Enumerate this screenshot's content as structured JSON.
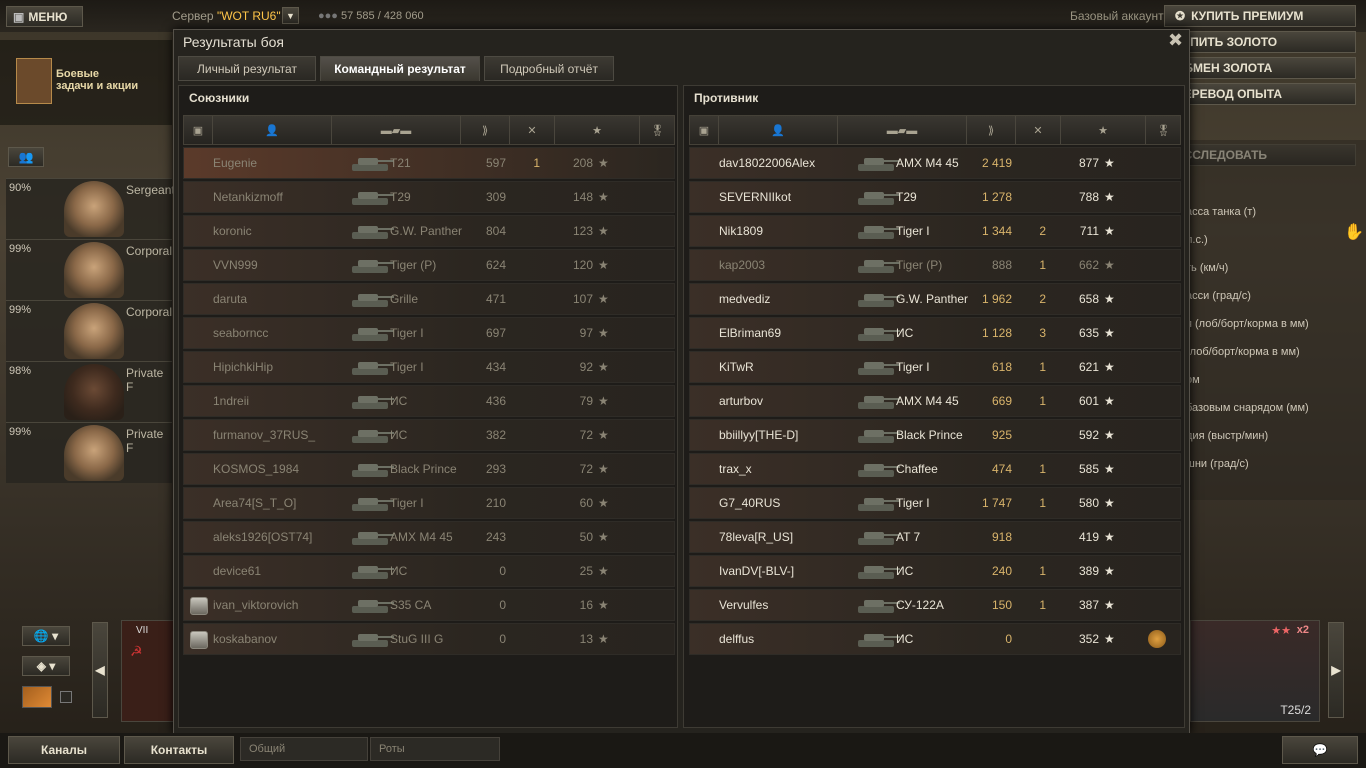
{
  "topbar": {
    "menu_label": "МЕНЮ",
    "server_label": "Сервер",
    "server_name": "\"WOT RU6\"",
    "online": "57 585 / 428 060",
    "account": "Базовый аккаунт"
  },
  "right_buttons": [
    "КУПИТЬ ПРЕМИУМ",
    "КУПИТЬ ЗОЛОТО",
    "ОБМЕН ЗОЛОТА",
    "ПЕРЕВОД ОПЫТА",
    "ИССЛЕДОВАТЬ"
  ],
  "right_stats": [
    "асса танка (т)",
    "л.с.)",
    "ть (км/ч)",
    "асси (град/с)",
    "я (лоб/борт/корма в мм)",
    "(лоб/борт/корма в мм)",
    "ом",
    "базовым снарядом (мм)",
    "дия (выстр/мин)",
    "шни (град/с)"
  ],
  "missions": {
    "line1": "Боевые",
    "line2": "задачи и акции"
  },
  "crew": [
    {
      "pct": "90%",
      "rank": "Sergeant"
    },
    {
      "pct": "99%",
      "rank": "Corporal"
    },
    {
      "pct": "99%",
      "rank": "Corporal"
    },
    {
      "pct": "98%",
      "rank": "Private F"
    },
    {
      "pct": "99%",
      "rank": "Private F"
    }
  ],
  "dialog": {
    "title": "Результаты боя",
    "tabs": [
      "Личный результат",
      "Командный результат",
      "Подробный отчёт"
    ],
    "active_tab": 1,
    "allies_title": "Союзники",
    "enemies_title": "Противник"
  },
  "allies": [
    {
      "name": "Eugenie",
      "tank": "T21",
      "dmg": "597",
      "kills": "1",
      "xp": "208",
      "self": true,
      "medal": false
    },
    {
      "name": "Netankizmoff",
      "tank": "T29",
      "dmg": "309",
      "kills": "",
      "xp": "148",
      "medal": false
    },
    {
      "name": "koronic",
      "tank": "G.W. Panther",
      "dmg": "804",
      "kills": "",
      "xp": "123",
      "medal": false
    },
    {
      "name": "VVN999",
      "tank": "Tiger (P)",
      "dmg": "624",
      "kills": "",
      "xp": "120",
      "medal": false
    },
    {
      "name": "daruta",
      "tank": "Grille",
      "dmg": "471",
      "kills": "",
      "xp": "107",
      "medal": false
    },
    {
      "name": "seaborncc",
      "tank": "Tiger I",
      "dmg": "697",
      "kills": "",
      "xp": "97",
      "medal": false
    },
    {
      "name": "HipichkiHip",
      "tank": "Tiger I",
      "dmg": "434",
      "kills": "",
      "xp": "92",
      "medal": false
    },
    {
      "name": "1ndreii",
      "tank": "ИС",
      "dmg": "436",
      "kills": "",
      "xp": "79",
      "medal": false
    },
    {
      "name": "furmanov_37RUS_",
      "tank": "ИС",
      "dmg": "382",
      "kills": "",
      "xp": "72",
      "medal": false
    },
    {
      "name": "KOSMOS_1984",
      "tank": "Black Prince",
      "dmg": "293",
      "kills": "",
      "xp": "72",
      "medal": false
    },
    {
      "name": "Area74[S_T_O]",
      "tank": "Tiger I",
      "dmg": "210",
      "kills": "",
      "xp": "60",
      "medal": false
    },
    {
      "name": "aleks1926[OST74]",
      "tank": "AMX M4 45",
      "dmg": "243",
      "kills": "",
      "xp": "50",
      "medal": false
    },
    {
      "name": "device61",
      "tank": "ИС",
      "dmg": "0",
      "kills": "",
      "xp": "25",
      "medal": false
    },
    {
      "name": "ivan_viktorovich",
      "tank": "S35 CA",
      "dmg": "0",
      "kills": "",
      "xp": "16",
      "medal": true
    },
    {
      "name": "koskabanov",
      "tank": "StuG III G",
      "dmg": "0",
      "kills": "",
      "xp": "13",
      "medal": true
    }
  ],
  "enemies": [
    {
      "name": "dav18022006Alex",
      "tank": "AMX M4 45",
      "dmg": "2 419",
      "kills": "",
      "xp": "877",
      "alive": true
    },
    {
      "name": "SEVERNIIkot",
      "tank": "T29",
      "dmg": "1 278",
      "kills": "",
      "xp": "788",
      "alive": true
    },
    {
      "name": "Nik1809",
      "tank": "Tiger I",
      "dmg": "1 344",
      "kills": "2",
      "xp": "711",
      "alive": true
    },
    {
      "name": "kap2003",
      "tank": "Tiger (P)",
      "dmg": "888",
      "kills": "1",
      "xp": "662",
      "alive": false
    },
    {
      "name": "medvediz",
      "tank": "G.W. Panther",
      "dmg": "1 962",
      "kills": "2",
      "xp": "658",
      "alive": true
    },
    {
      "name": "ElBriman69",
      "tank": "ИС",
      "dmg": "1 128",
      "kills": "3",
      "xp": "635",
      "alive": true
    },
    {
      "name": "KiTwR",
      "tank": "Tiger I",
      "dmg": "618",
      "kills": "1",
      "xp": "621",
      "alive": true
    },
    {
      "name": "arturbov",
      "tank": "AMX M4 45",
      "dmg": "669",
      "kills": "1",
      "xp": "601",
      "alive": true
    },
    {
      "name": "bbiillyy[THE-D]",
      "tank": "Black Prince",
      "dmg": "925",
      "kills": "",
      "xp": "592",
      "alive": true
    },
    {
      "name": "trax_x",
      "tank": "Chaffee",
      "dmg": "474",
      "kills": "1",
      "xp": "585",
      "alive": true
    },
    {
      "name": "G7_40RUS",
      "tank": "Tiger I",
      "dmg": "1 747",
      "kills": "1",
      "xp": "580",
      "alive": true
    },
    {
      "name": "78leva[R_US]",
      "tank": "AT 7",
      "dmg": "918",
      "kills": "",
      "xp": "419",
      "alive": true
    },
    {
      "name": "IvanDV[-BLV-]",
      "tank": "ИС",
      "dmg": "240",
      "kills": "1",
      "xp": "389",
      "alive": true
    },
    {
      "name": "Vervulfes",
      "tank": "СУ-122А",
      "dmg": "150",
      "kills": "1",
      "xp": "387",
      "alive": true
    },
    {
      "name": "delffus",
      "tank": "ИС",
      "dmg": "0",
      "kills": "",
      "xp": "352",
      "alive": true,
      "achievement": true
    }
  ],
  "carousel": {
    "tier": "VII",
    "right_tank": "T25/2",
    "right_badge": "x2"
  },
  "bottom": {
    "channels": "Каналы",
    "contacts": "Контакты",
    "general": "Общий",
    "companies": "Роты"
  },
  "colors": {
    "accent_gold": "#ffc64a",
    "xp": "#d9b46b"
  }
}
